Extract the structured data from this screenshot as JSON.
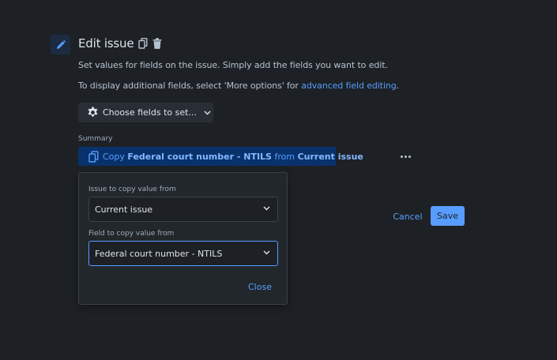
{
  "header": {
    "title": "Edit issue",
    "icons": [
      "pencil-icon",
      "copy-icon",
      "trash-icon"
    ]
  },
  "description": {
    "line1": "Set values for fields on the issue. Simply add the fields you want to edit.",
    "line2_prefix": "To display additional fields, select 'More options' for ",
    "line2_link": "advanced field editing",
    "line2_suffix": "."
  },
  "choose_fields": {
    "label": "Choose fields to set...",
    "icon": "gear-icon"
  },
  "summary": {
    "label": "Summary",
    "copy_prefix": "Copy ",
    "field_name": "Federal court number - NTILS",
    "from_text": " from ",
    "source": "Current issue"
  },
  "popup": {
    "issue_label": "Issue to copy value from",
    "issue_value": "Current issue",
    "field_label": "Field to copy value from",
    "field_value": "Federal court number - NTILS",
    "close_label": "Close"
  },
  "actions": {
    "cancel_label": "Cancel",
    "save_label": "Save"
  },
  "colors": {
    "background": "#1d2125",
    "accent": "#579dff",
    "summary_bg": "#09326c"
  }
}
